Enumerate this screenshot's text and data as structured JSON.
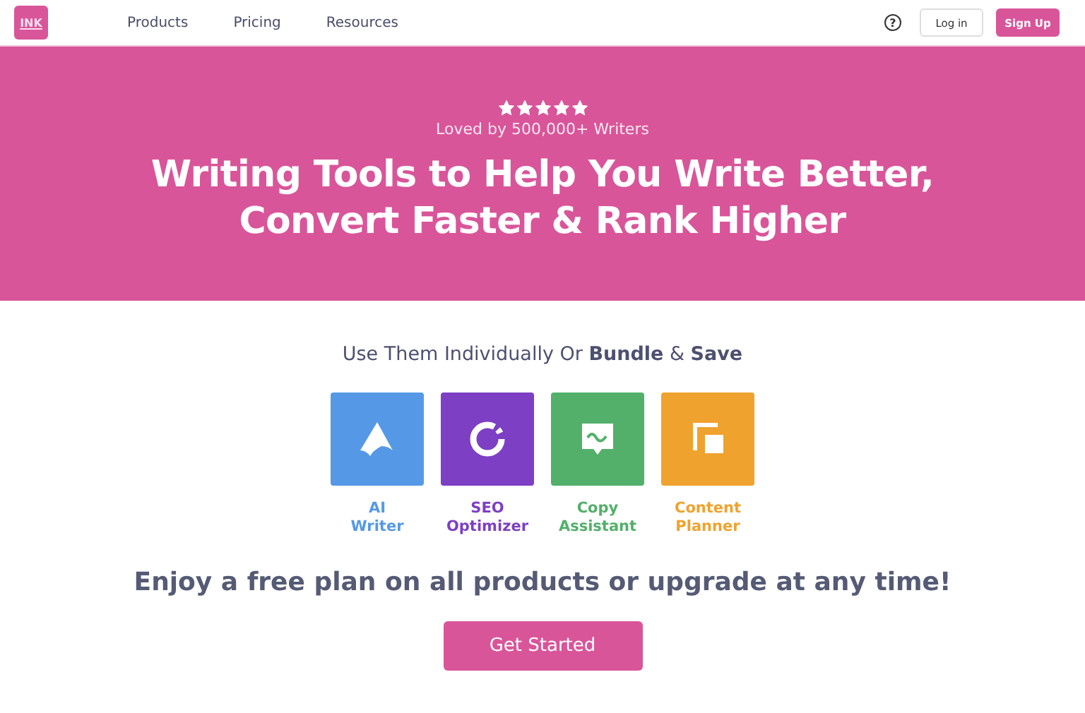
{
  "header": {
    "logo": "INK",
    "nav": [
      "Products",
      "Pricing",
      "Resources"
    ],
    "help_icon_text": "?",
    "login": "Log in",
    "signup": "Sign Up"
  },
  "hero": {
    "stars": 5,
    "tagline": "Loved by 500,000+ Writers",
    "title_lines": [
      "Writing Tools to Help You Write Better,",
      "Convert Faster & Rank Higher"
    ]
  },
  "products_heading": "Use Them Individually Or **Bundle** & **Save**",
  "products": [
    {
      "name_lines": [
        "AI",
        "Writer"
      ],
      "color": "#5599e6"
    },
    {
      "name_lines": [
        "SEO",
        "Optimizer"
      ],
      "color": "#7d3fc4"
    },
    {
      "name_lines": [
        "Copy",
        "Assistant"
      ],
      "color": "#52b06a"
    },
    {
      "name_lines": [
        "Content",
        "Planner"
      ],
      "color": "#f0a22e"
    }
  ],
  "offer": "Enjoy a free plan on all products or upgrade at any time!",
  "cta": "Get Started"
}
